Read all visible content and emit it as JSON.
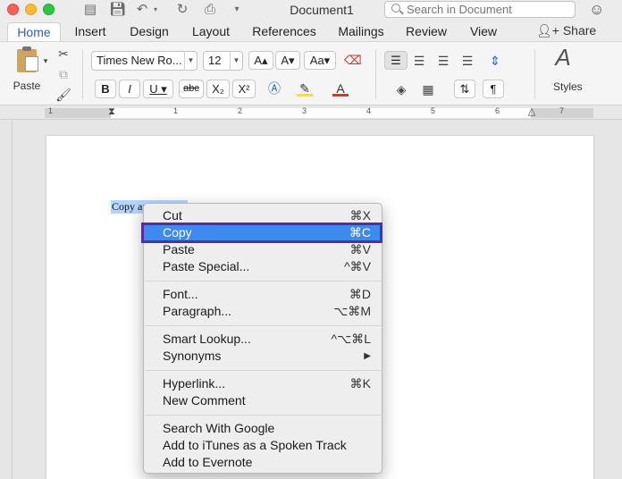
{
  "window": {
    "title": "Document1"
  },
  "search": {
    "placeholder": "Search in Document"
  },
  "tabs": [
    "Home",
    "Insert",
    "Design",
    "Layout",
    "References",
    "Mailings",
    "Review",
    "View"
  ],
  "share_label": "Share",
  "ribbon": {
    "paste_label": "Paste",
    "font_name": "Times New Ro...",
    "font_size": "12",
    "bold": "B",
    "italic": "I",
    "underline": "U",
    "strike": "abc",
    "subscript": "X₂",
    "superscript": "X²",
    "styles_label": "Styles",
    "pilcrow": "¶"
  },
  "ruler": {
    "numbers": [
      "1",
      "1",
      "2",
      "3",
      "4",
      "5",
      "6",
      "7"
    ]
  },
  "document": {
    "selected_text": "Copy and paste"
  },
  "context_menu": {
    "items": [
      {
        "label": "Cut",
        "shortcut": "⌘X"
      },
      {
        "label": "Copy",
        "shortcut": "⌘C"
      },
      {
        "label": "Paste",
        "shortcut": "⌘V"
      },
      {
        "label": "Paste Special...",
        "shortcut": "^⌘V"
      },
      {
        "label": "Font...",
        "shortcut": "⌘D"
      },
      {
        "label": "Paragraph...",
        "shortcut": "⌥⌘M"
      },
      {
        "label": "Smart Lookup...",
        "shortcut": "^⌥⌘L"
      },
      {
        "label": "Synonyms",
        "shortcut": "▶"
      },
      {
        "label": "Hyperlink...",
        "shortcut": "⌘K"
      },
      {
        "label": "New Comment",
        "shortcut": ""
      },
      {
        "label": "Search With Google",
        "shortcut": ""
      },
      {
        "label": "Add to iTunes as a Spoken Track",
        "shortcut": ""
      },
      {
        "label": "Add to Evernote",
        "shortcut": ""
      }
    ]
  },
  "colors": {
    "accent": "#3e8bf0",
    "highlight_frame": "#5a2aa0",
    "tab_active": "#2b62b8"
  }
}
